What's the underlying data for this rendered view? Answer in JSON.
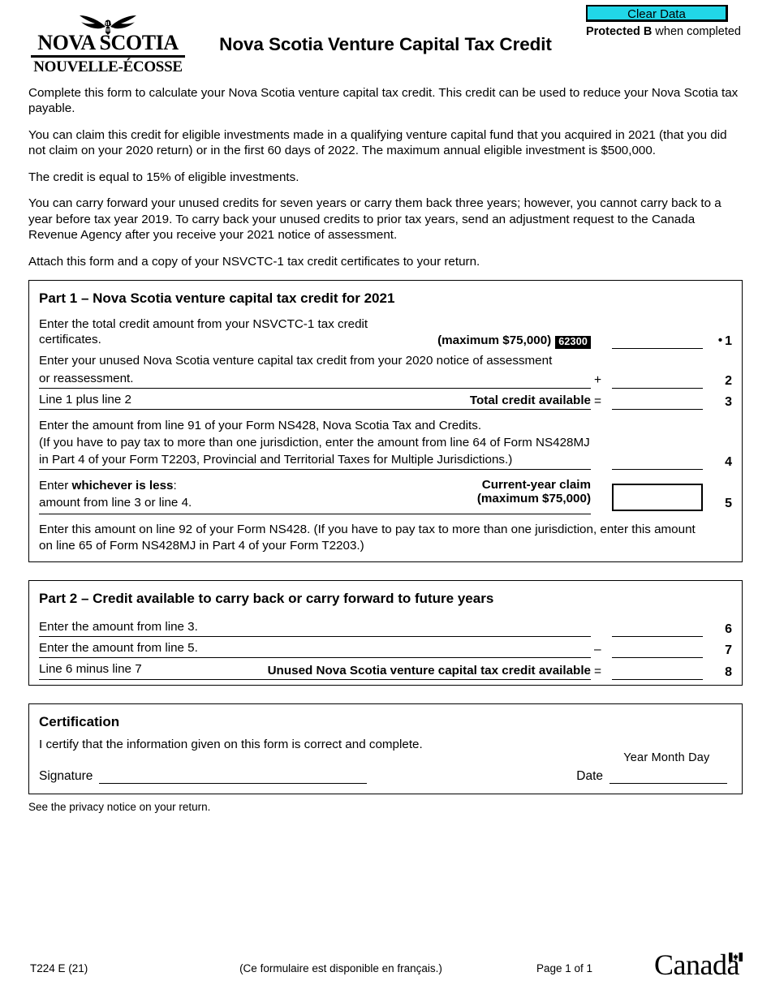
{
  "header": {
    "clear_data_label": "Clear Data",
    "protected_bold": "Protected B",
    "protected_rest": " when completed",
    "logo_line1": "NOVA SCOTIA",
    "logo_line2": "NOUVELLE-ÉCOSSE",
    "form_title": "Nova Scotia Venture Capital Tax Credit"
  },
  "intro": {
    "p1": "Complete this form to calculate your Nova Scotia venture capital tax credit. This credit can be used to reduce your Nova Scotia tax payable.",
    "p2": "You can claim this credit for eligible investments made in a qualifying venture capital fund that you acquired in 2021 (that you did not claim on your 2020 return) or in the first 60 days of 2022. The maximum annual eligible investment is $500,000.",
    "p3": "The credit is equal to 15% of eligible investments.",
    "p4": "You can carry forward your unused credits for seven years or carry them back three years; however, you cannot carry back to a year before tax year 2019. To carry back your unused credits to prior tax years, send an adjustment request to the Canada Revenue Agency after you receive your 2021 notice of assessment.",
    "p5": "Attach this form and a copy of your NSVCTC-1 tax credit certificates to your return."
  },
  "part1": {
    "title": "Part 1 – Nova Scotia venture capital tax credit for 2021",
    "line1": {
      "label": "Enter the total credit amount from your NSVCTC-1 tax credit certificates.",
      "maximum": "(maximum $75,000)",
      "field_code": "62300",
      "number": "1",
      "value": ""
    },
    "line2": {
      "label_a": "Enter your unused Nova Scotia venture capital tax credit from your 2020 notice of assessment",
      "label_b": "or reassessment.",
      "operator": "+",
      "number": "2",
      "value": ""
    },
    "line3": {
      "label": "Line 1 plus line 2",
      "bold_label": "Total credit available",
      "operator": "=",
      "number": "3",
      "value": ""
    },
    "line4": {
      "label_a": "Enter the amount from line 91 of your Form NS428, Nova Scotia Tax and Credits.",
      "label_b": "(If you have to pay tax to more than one jurisdiction, enter the amount from line 64 of Form NS428MJ",
      "label_c": "in Part 4 of your Form T2203, Provincial and Territorial Taxes for Multiple Jurisdictions.)",
      "number": "4",
      "value": ""
    },
    "line5": {
      "label_a_pre": "Enter ",
      "label_a_bold": "whichever is less",
      "label_a_post": ":",
      "label_b": "amount from line 3 or line 4.",
      "bold_label": "Current-year claim",
      "maximum": "(maximum $75,000)",
      "number": "5",
      "value": ""
    },
    "note_a": "Enter this amount on line 92 of your Form NS428. (If you have to pay tax to more than one jurisdiction, enter this amount",
    "note_b": "on line 65 of Form NS428MJ in Part 4 of your Form T2203.)"
  },
  "part2": {
    "title": "Part 2 – Credit available to carry back or carry forward to future years",
    "line6": {
      "label": "Enter the amount from line 3.",
      "number": "6",
      "value": ""
    },
    "line7": {
      "label": "Enter the amount from line 5.",
      "operator": "–",
      "number": "7",
      "value": ""
    },
    "line8": {
      "label": "Line 6 minus line 7",
      "bold_label": "Unused Nova Scotia venture capital tax credit available",
      "operator": "=",
      "number": "8",
      "value": ""
    }
  },
  "certification": {
    "title": "Certification",
    "statement": "I certify that the information given on this form is correct and complete.",
    "signature_label": "Signature",
    "signature_value": "",
    "date_label": "Date",
    "date_value": "",
    "ymd_label": "Year  Month  Day"
  },
  "privacy_note": "See the privacy notice on your return.",
  "footer": {
    "form_code": "T224 E (21)",
    "french_note": "(Ce formulaire est disponible en français.)",
    "page_label": "Page 1 of 1",
    "wordmark": "Canada"
  },
  "colors": {
    "clear_data_bg": "#21d7e8",
    "ink": "#000000",
    "paper": "#ffffff"
  }
}
